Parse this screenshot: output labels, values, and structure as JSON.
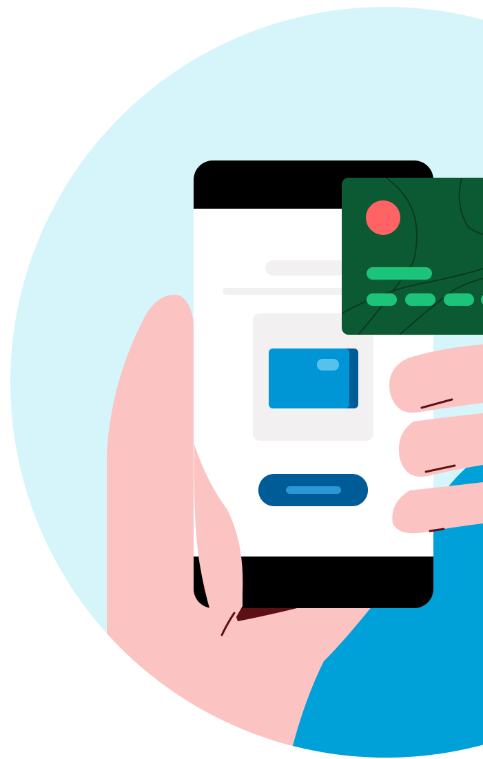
{
  "illustration": {
    "subject": "hand-holding-phone-with-credit-card",
    "colors": {
      "background": "#ffffff",
      "circle": "#d6f5fa",
      "sleeve": "#00a0d9",
      "skin": "#fcc3c3",
      "skin_line": "#5c0f14",
      "phone_body": "#000000",
      "phone_screen": "#ffffff",
      "screen_placeholder": "#f2f0f0",
      "screen_card": "#0096d6",
      "screen_card_accent": "#55c1ec",
      "screen_card_edge": "#005c97",
      "screen_button": "#005c97",
      "screen_button_bar": "#2a97d8",
      "credit_card": "#0c5a34",
      "credit_card_lines": "#0a3a22",
      "credit_card_chip": "#ff6363",
      "credit_card_digits": "#1cc47a"
    },
    "credit_card": {
      "chip_icon": "circle-chip",
      "digit_groups_visible": 4
    }
  }
}
